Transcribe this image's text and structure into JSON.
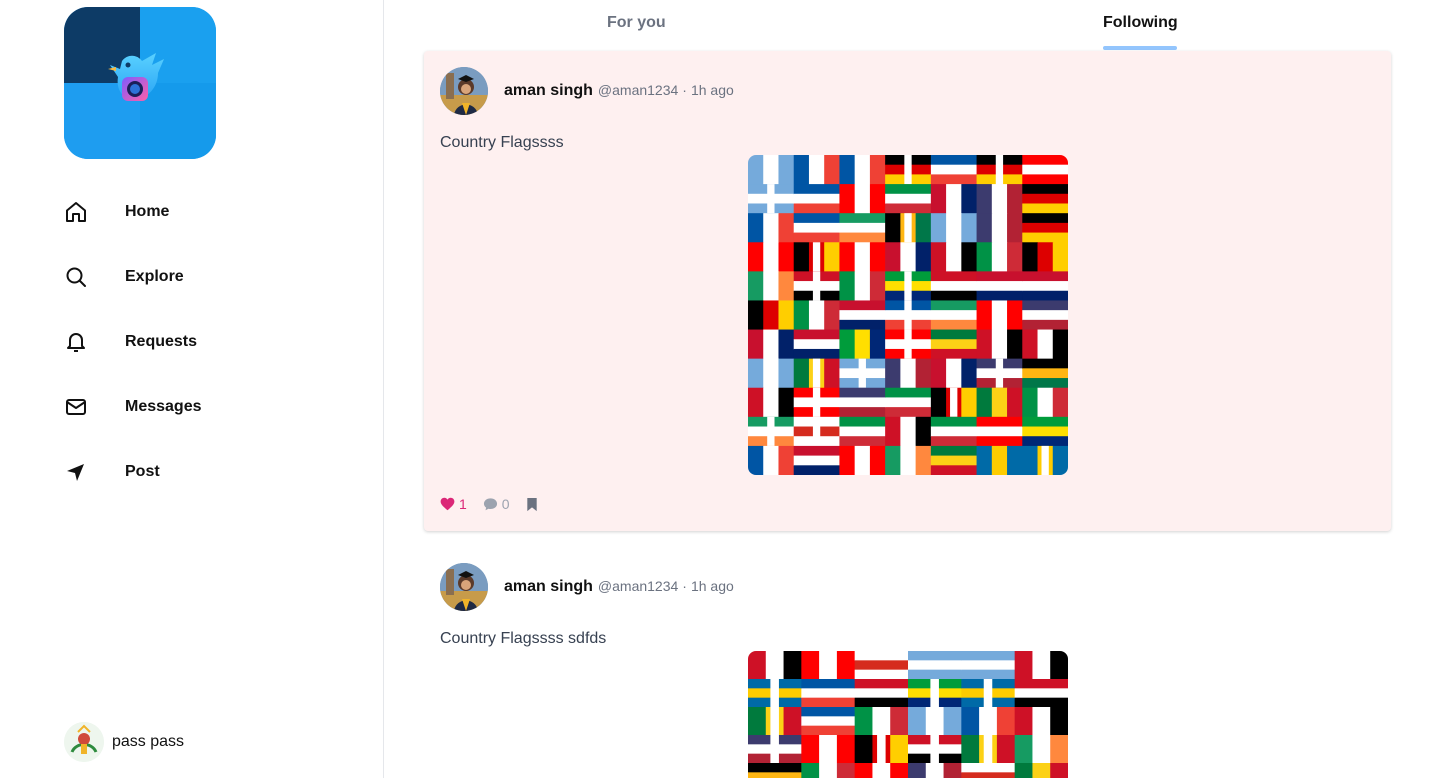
{
  "sidebar": {
    "logo_icon": "bird-camera-logo",
    "items": [
      {
        "label": "Home",
        "icon": "home-icon"
      },
      {
        "label": "Explore",
        "icon": "search-icon"
      },
      {
        "label": "Requests",
        "icon": "bell-icon"
      },
      {
        "label": "Messages",
        "icon": "mail-icon"
      },
      {
        "label": "Post",
        "icon": "send-icon"
      }
    ],
    "profile": {
      "name": "pass pass"
    }
  },
  "tabs": {
    "for_you": "For you",
    "following": "Following",
    "active": "Following",
    "underline_color": "#93c5fd"
  },
  "posts": [
    {
      "name": "aman singh",
      "handle": "@aman1234",
      "separator": "·",
      "time": "1h ago",
      "text": "Country Flagssss",
      "likes": "1",
      "comments": "0",
      "liked": true,
      "background": "#fef0f0"
    },
    {
      "name": "aman singh",
      "handle": "@aman1234",
      "separator": "·",
      "time": "1h ago",
      "text": "Country Flagssss sdfds"
    }
  ],
  "colors": {
    "like": "#db2777",
    "muted": "#9ca3af",
    "brand": "#1da1f2"
  }
}
